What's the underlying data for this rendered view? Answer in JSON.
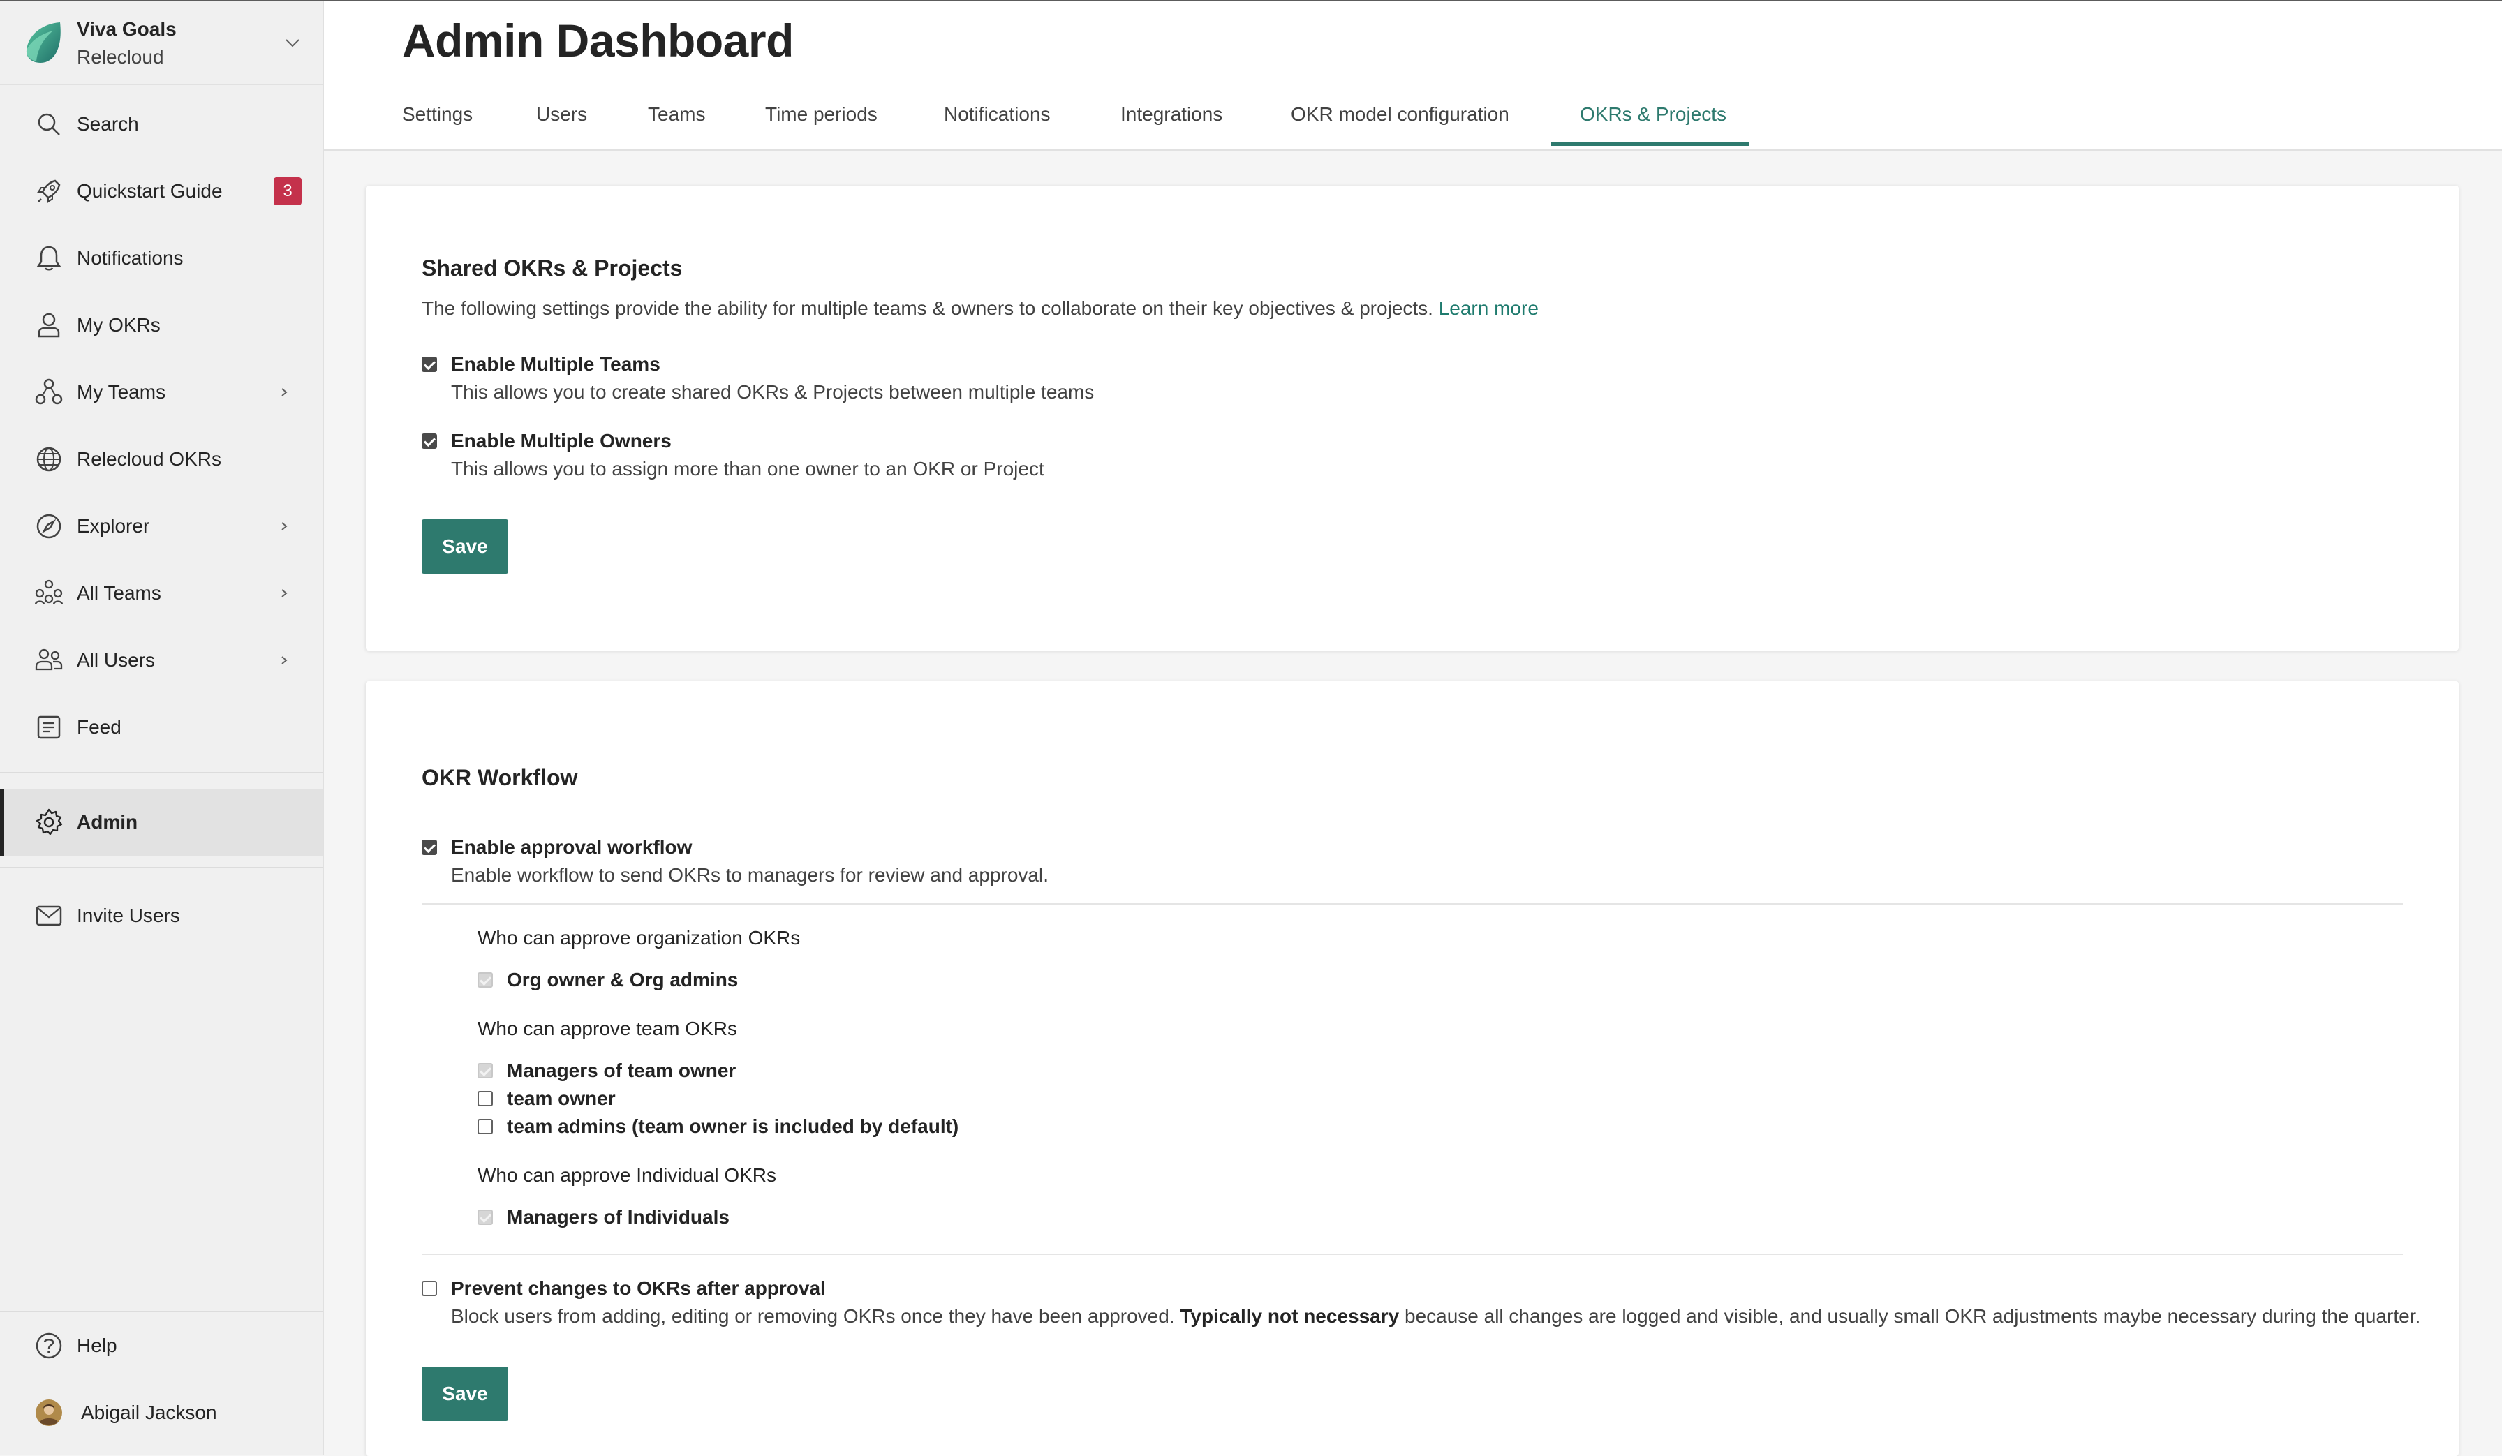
{
  "app": {
    "name": "Viva Goals",
    "org": "Relecloud"
  },
  "sidebar": {
    "items": [
      {
        "label": "Search",
        "icon": "search-icon"
      },
      {
        "label": "Quickstart Guide",
        "icon": "rocket-icon",
        "badge": "3"
      },
      {
        "label": "Notifications",
        "icon": "bell-icon"
      },
      {
        "label": "My OKRs",
        "icon": "person-icon"
      },
      {
        "label": "My Teams",
        "icon": "team-icon",
        "expandable": true
      },
      {
        "label": "Relecloud OKRs",
        "icon": "globe-icon"
      },
      {
        "label": "Explorer",
        "icon": "compass-icon",
        "expandable": true
      },
      {
        "label": "All Teams",
        "icon": "people-team-icon",
        "expandable": true
      },
      {
        "label": "All Users",
        "icon": "people-icon",
        "expandable": true
      },
      {
        "label": "Feed",
        "icon": "feed-icon"
      },
      {
        "label": "Admin",
        "icon": "gear-icon",
        "active": true
      },
      {
        "label": "Invite Users",
        "icon": "mail-icon"
      }
    ],
    "footer": {
      "help": "Help",
      "user": "Abigail Jackson"
    }
  },
  "header": {
    "title": "Admin Dashboard",
    "tabs": [
      {
        "label": "Settings"
      },
      {
        "label": "Users"
      },
      {
        "label": "Teams"
      },
      {
        "label": "Time periods"
      },
      {
        "label": "Notifications"
      },
      {
        "label": "Integrations"
      },
      {
        "label": "OKR model configuration"
      },
      {
        "label": "OKRs & Projects",
        "active": true
      }
    ]
  },
  "shared": {
    "title": "Shared OKRs & Projects",
    "description": "The following settings provide the ability for multiple teams & owners to collaborate on their key objectives & projects.",
    "learn_more": "Learn more",
    "options": [
      {
        "label": "Enable Multiple Teams",
        "help": "This allows you to create shared OKRs & Projects between multiple teams",
        "checked": true
      },
      {
        "label": "Enable Multiple Owners",
        "help": "This allows you to assign more than one owner to an OKR or Project",
        "checked": true
      }
    ],
    "save_label": "Save"
  },
  "workflow": {
    "title": "OKR Workflow",
    "approval": {
      "label": "Enable approval workflow",
      "help": "Enable workflow to send OKRs to managers for review and approval.",
      "checked": true
    },
    "org_heading": "Who can approve organization OKRs",
    "org_options": [
      {
        "label": "Org owner & Org admins",
        "checked": true,
        "disabled": true
      }
    ],
    "team_heading": "Who can approve team OKRs",
    "team_options": [
      {
        "label": "Managers of team owner",
        "checked": true,
        "disabled": true
      },
      {
        "label": "team owner",
        "checked": false
      },
      {
        "label": "team admins (team owner is included by default)",
        "checked": false
      }
    ],
    "individual_heading": "Who can approve Individual OKRs",
    "individual_options": [
      {
        "label": "Managers of Individuals",
        "checked": true,
        "disabled": true
      }
    ],
    "prevent": {
      "label": "Prevent changes to OKRs after approval",
      "help_pre": "Block users from adding, editing or removing OKRs once they have been approved.",
      "help_bold": "Typically not necessary",
      "help_post": "because all changes are logged and visible, and usually small OKR adjustments maybe necessary during the quarter.",
      "checked": false
    },
    "save_label": "Save"
  },
  "colors": {
    "accent": "#2e7a6e",
    "badge": "#c4314b",
    "active_bg": "#e2e2e2"
  }
}
